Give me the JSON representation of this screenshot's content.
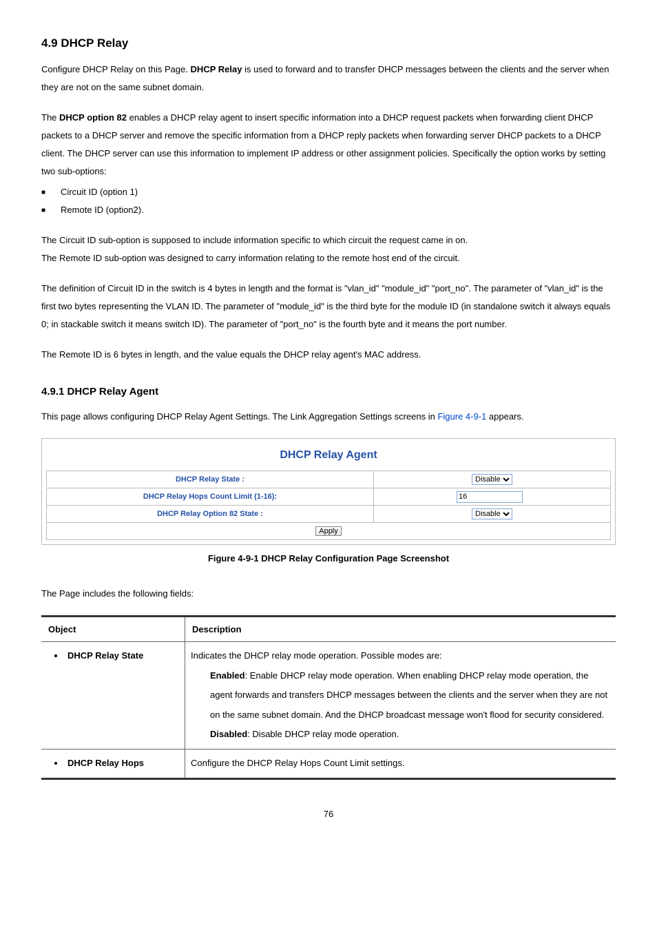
{
  "section": {
    "title": "4.9 DHCP Relay",
    "intro_p1a": "Configure DHCP Relay on this Page. ",
    "intro_p1_bold": "DHCP Relay",
    "intro_p1b": " is used to forward and to transfer DHCP messages between the clients and the server when they are not on the same subnet domain.",
    "intro_p2a": "The ",
    "intro_p2_bold": "DHCP option 82",
    "intro_p2b": " enables a DHCP relay agent to insert specific information into a DHCP request packets when forwarding client DHCP packets to a DHCP server and remove the specific information from a DHCP reply packets when forwarding server DHCP packets to a DHCP client. The DHCP server can use this information to implement IP address or other assignment policies. Specifically the option works by setting two sub-options:",
    "sub_options": [
      "Circuit ID (option 1)",
      "Remote ID (option2)."
    ],
    "p3": "The Circuit ID sub-option is supposed to include information specific to which circuit the request came in on.",
    "p4": "The Remote ID sub-option was designed to carry information relating to the remote host end of the circuit.",
    "p5": "The definition of Circuit ID in the switch is 4 bytes in length and the format is \"vlan_id\" \"module_id\" \"port_no\". The parameter of \"vlan_id\" is the first two bytes representing the VLAN ID. The parameter of \"module_id\" is the third byte for the module ID (in standalone switch it always equals 0; in stackable switch it means switch ID). The parameter of \"port_no\" is the fourth byte and it means the port number.",
    "p6": "The Remote ID is 6 bytes in length, and the value equals the DHCP relay agent's MAC address."
  },
  "subsection": {
    "title": "4.9.1 DHCP Relay Agent",
    "intro_a": "This page allows configuring DHCP Relay Agent Settings. The Link Aggregation Settings screens in ",
    "intro_link": "Figure 4-9-1",
    "intro_b": " appears."
  },
  "screenshot": {
    "title": "DHCP Relay Agent",
    "rows": [
      {
        "label": "DHCP Relay State :",
        "type": "select",
        "value": "Disable"
      },
      {
        "label": "DHCP Relay Hops Count Limit (1-16):",
        "type": "input",
        "value": "16"
      },
      {
        "label": "DHCP Relay Option 82 State :",
        "type": "select",
        "value": "Disable"
      }
    ],
    "apply_label": "Apply"
  },
  "caption_prefix": "Figure 4-9-1 ",
  "caption_text": "DHCP Relay Configuration Page Screenshot",
  "fields_intro": "The Page includes the following fields:",
  "table": {
    "head_obj": "Object",
    "head_desc": "Description",
    "row1_obj": "DHCP Relay State",
    "row1_line1": "Indicates the DHCP relay mode operation. Possible modes are:",
    "row1_enabled_label": "Enabled",
    "row1_enabled_text": ": Enable DHCP relay mode operation. When enabling DHCP relay mode operation, the agent forwards and transfers DHCP messages between the clients and the server when they are not on the same subnet domain. And the DHCP broadcast message won't flood for security considered.",
    "row1_disabled_label": "Disabled",
    "row1_disabled_text": ": Disable DHCP relay mode operation.",
    "row2_obj": "DHCP Relay Hops",
    "row2_desc": "Configure the DHCP Relay Hops Count Limit settings."
  },
  "page_number": "76"
}
